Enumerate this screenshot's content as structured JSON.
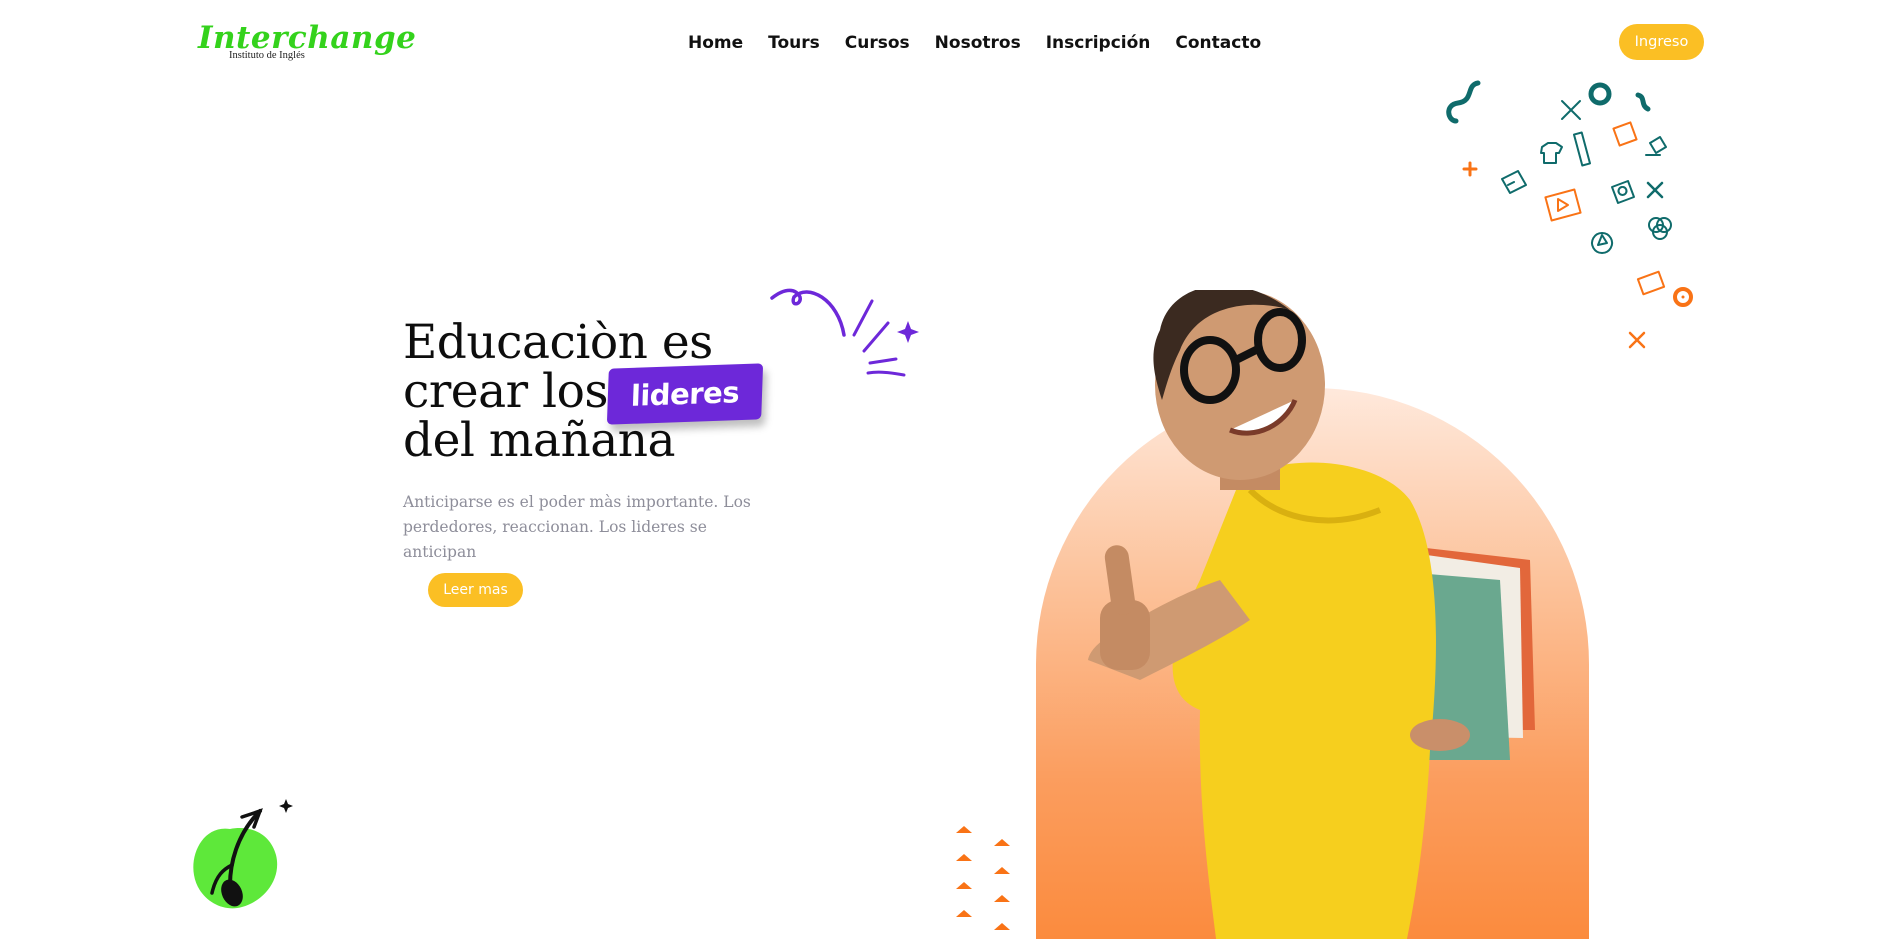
{
  "brand": {
    "name": "Interchange",
    "tagline": "Instituto de Inglés",
    "color": "#34d21c"
  },
  "nav": {
    "items": [
      {
        "label": "Home"
      },
      {
        "label": "Tours"
      },
      {
        "label": "Cursos"
      },
      {
        "label": "Nosotros"
      },
      {
        "label": "Inscripción"
      },
      {
        "label": "Contacto"
      }
    ]
  },
  "header": {
    "login_label": "Ingreso"
  },
  "hero": {
    "title_line1": "Educaciòn es",
    "title_line2": "crear los",
    "title_line3": "del mañana",
    "highlight": "lideres",
    "subtitle": "Anticiparse es el poder màs importante. Los perdedores, reaccionan. Los lideres se anticipan",
    "cta_label": "Leer mas"
  },
  "colors": {
    "accent_yellow": "#fbbf24",
    "accent_purple": "#6d28d9",
    "accent_orange": "#f97316",
    "accent_teal": "#0f6b6b",
    "apple_green": "#5ee83a"
  },
  "icons": [
    "squiggle-icon",
    "ring-icon",
    "pencil-ruler-icon",
    "tshirt-icon",
    "ruler-icon",
    "tape-measure-icon",
    "paint-bucket-icon",
    "plus-icon",
    "ticket-icon",
    "video-play-icon",
    "camera-icon",
    "crossed-tools-icon",
    "rgb-circles-icon",
    "color-wheel-icon",
    "photo-icon",
    "dot-circle-icon",
    "sparkle-icon",
    "apple-icon",
    "triangle-pattern-icon"
  ]
}
